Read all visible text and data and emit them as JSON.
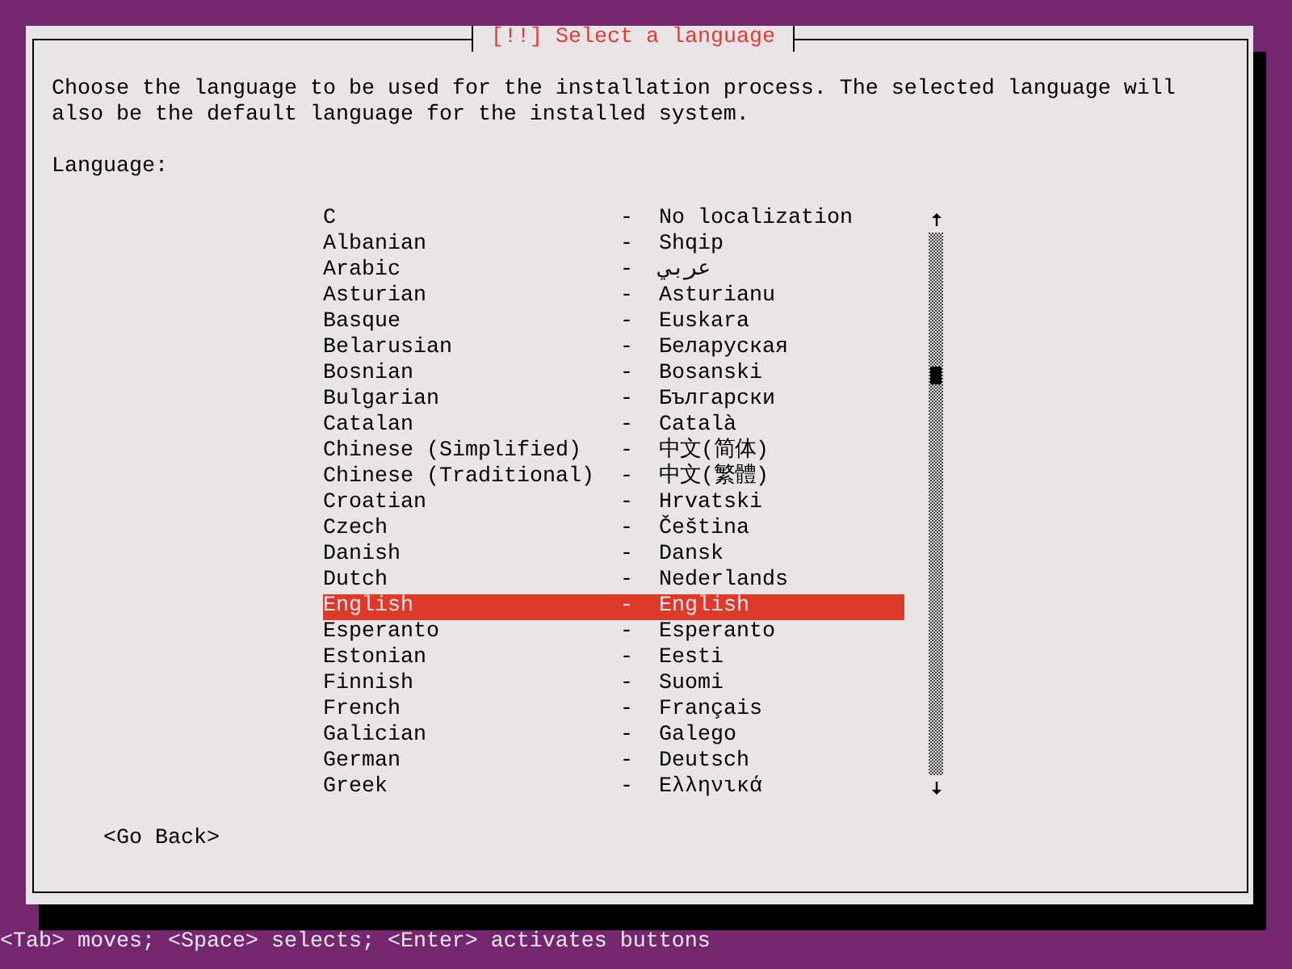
{
  "dialog": {
    "title": "[!!] Select a language",
    "description": "Choose the language to be used for the installation process. The selected language will also be the default language for the installed system.",
    "field_label": "Language:",
    "languages": [
      {
        "name": "C",
        "separator": "-",
        "native": "No localization",
        "selected": false
      },
      {
        "name": "Albanian",
        "separator": "-",
        "native": "Shqip",
        "selected": false
      },
      {
        "name": "Arabic",
        "separator": "-",
        "native": "عربي",
        "selected": false
      },
      {
        "name": "Asturian",
        "separator": "-",
        "native": "Asturianu",
        "selected": false
      },
      {
        "name": "Basque",
        "separator": "-",
        "native": "Euskara",
        "selected": false
      },
      {
        "name": "Belarusian",
        "separator": "-",
        "native": "Беларуская",
        "selected": false
      },
      {
        "name": "Bosnian",
        "separator": "-",
        "native": "Bosanski",
        "selected": false
      },
      {
        "name": "Bulgarian",
        "separator": "-",
        "native": "Български",
        "selected": false
      },
      {
        "name": "Catalan",
        "separator": "-",
        "native": "Català",
        "selected": false
      },
      {
        "name": "Chinese (Simplified)",
        "separator": "-",
        "native": "中文(简体)",
        "selected": false
      },
      {
        "name": "Chinese (Traditional)",
        "separator": "-",
        "native": "中文(繁體)",
        "selected": false
      },
      {
        "name": "Croatian",
        "separator": "-",
        "native": "Hrvatski",
        "selected": false
      },
      {
        "name": "Czech",
        "separator": "-",
        "native": "Čeština",
        "selected": false
      },
      {
        "name": "Danish",
        "separator": "-",
        "native": "Dansk",
        "selected": false
      },
      {
        "name": "Dutch",
        "separator": "-",
        "native": "Nederlands",
        "selected": false
      },
      {
        "name": "English",
        "separator": "-",
        "native": "English",
        "selected": true
      },
      {
        "name": "Esperanto",
        "separator": "-",
        "native": "Esperanto",
        "selected": false
      },
      {
        "name": "Estonian",
        "separator": "-",
        "native": "Eesti",
        "selected": false
      },
      {
        "name": "Finnish",
        "separator": "-",
        "native": "Suomi",
        "selected": false
      },
      {
        "name": "French",
        "separator": "-",
        "native": "Français",
        "selected": false
      },
      {
        "name": "Galician",
        "separator": "-",
        "native": "Galego",
        "selected": false
      },
      {
        "name": "German",
        "separator": "-",
        "native": "Deutsch",
        "selected": false
      },
      {
        "name": "Greek",
        "separator": "-",
        "native": "Ελληνικά",
        "selected": false
      }
    ],
    "buttons": [
      "<Go Back>"
    ]
  },
  "status_bar": "<Tab> moves; <Space> selects; <Enter> activates buttons"
}
